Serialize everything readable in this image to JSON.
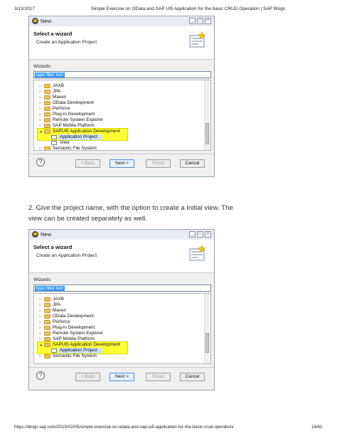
{
  "header": {
    "date": "3/13/2017",
    "title": "Simple Exercise on OData and SAP UI5 Application for the basic CRUD Operation | SAP Blogs"
  },
  "footer": {
    "url": "https://blogs.sap.com/2015/02/05/simple-exercise-on-odata-and-sap-ui5-application-for-the-basic-crud-operation/",
    "page": "16/61"
  },
  "step_text": {
    "line1": "2. Give the project name, with the option to create a Initial view. The",
    "line2": "view can be created separately as well."
  },
  "dialog1": {
    "title": "New",
    "banner_title": "Select a wizard",
    "banner_subtitle": "Create an Application Project",
    "wizards_label": "Wizards:",
    "filter_text": "type filter text",
    "tree": [
      {
        "label": "JAXB",
        "kind": "folder",
        "depth": 0
      },
      {
        "label": "JPA",
        "kind": "folder",
        "depth": 0
      },
      {
        "label": "Maven",
        "kind": "folder",
        "depth": 0
      },
      {
        "label": "OData Development",
        "kind": "folder",
        "depth": 0
      },
      {
        "label": "Perforce",
        "kind": "folder",
        "depth": 0
      },
      {
        "label": "Plug-in Development",
        "kind": "folder",
        "depth": 0
      },
      {
        "label": "Remote System Explorer",
        "kind": "folder",
        "depth": 0
      },
      {
        "label": "SAP Mobile Platform",
        "kind": "folder",
        "depth": 0
      },
      {
        "label": "SAPUI5 Application Development",
        "kind": "folder-open",
        "depth": 0
      },
      {
        "label": "Application Project",
        "kind": "item",
        "depth": 1
      },
      {
        "label": "View",
        "kind": "item",
        "depth": 1
      },
      {
        "label": "Semantic File System",
        "kind": "folder",
        "depth": 0
      }
    ],
    "buttons": {
      "back": "< Back",
      "next": "Next >",
      "finish": "Finish",
      "cancel": "Cancel"
    },
    "help": "?"
  },
  "dialog2": {
    "title": "New",
    "banner_title": "Select a wizard",
    "banner_subtitle": "Create an Application Project",
    "wizards_label": "Wizards:",
    "filter_text": "type filter text",
    "tree": [
      {
        "label": "JAXB",
        "kind": "folder",
        "depth": 0
      },
      {
        "label": "JPA",
        "kind": "folder",
        "depth": 0
      },
      {
        "label": "Maven",
        "kind": "folder",
        "depth": 0
      },
      {
        "label": "OData Development",
        "kind": "folder",
        "depth": 0
      },
      {
        "label": "Perforce",
        "kind": "folder",
        "depth": 0
      },
      {
        "label": "Plug-in Development",
        "kind": "folder",
        "depth": 0
      },
      {
        "label": "Remote System Explorer",
        "kind": "folder",
        "depth": 0
      },
      {
        "label": "SAP Mobile Platform",
        "kind": "folder",
        "depth": 0
      },
      {
        "label": "SAPUI5 Application Development",
        "kind": "folder-open",
        "depth": 0
      },
      {
        "label": "Application Project",
        "kind": "item",
        "depth": 1
      },
      {
        "label": "Semantic File System",
        "kind": "folder",
        "depth": 0
      }
    ],
    "buttons": {
      "back": "< Back",
      "next": "Next >",
      "finish": "Finish",
      "cancel": "Cancel"
    },
    "help": "?"
  },
  "colors": {
    "highlight": "#ffff33",
    "filter_selection": "#3399ff"
  }
}
